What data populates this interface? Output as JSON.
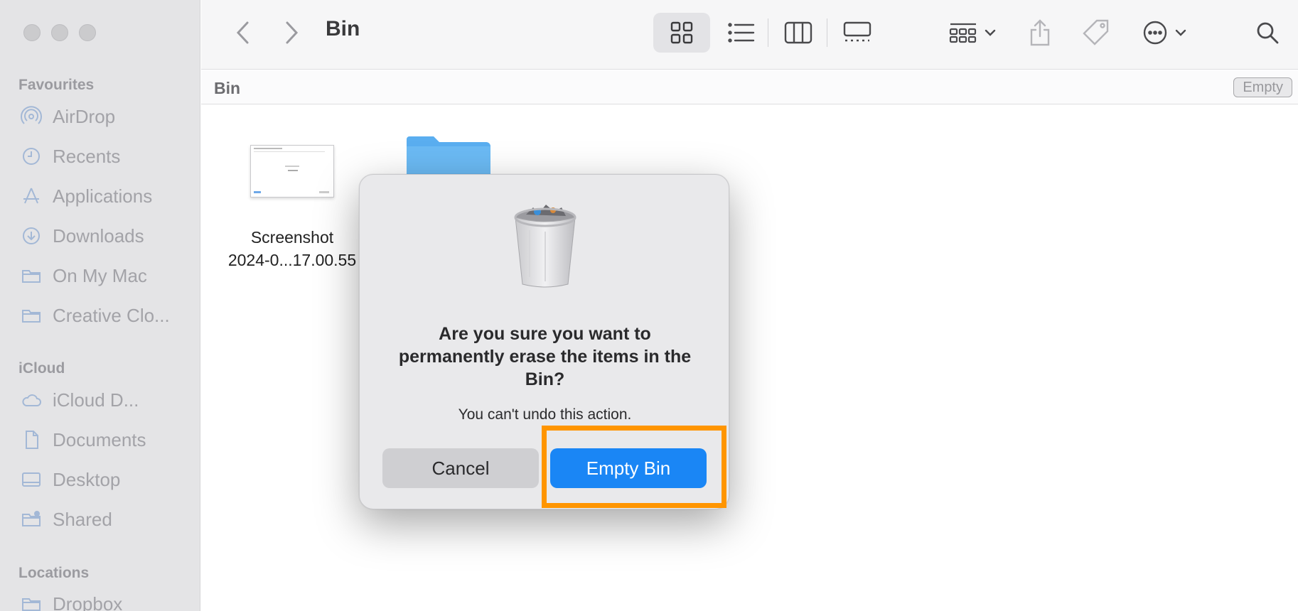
{
  "window": {
    "title": "Bin"
  },
  "sidebar": {
    "sections": [
      {
        "label": "Favourites",
        "items": [
          {
            "label": "AirDrop",
            "icon": "airdrop-icon"
          },
          {
            "label": "Recents",
            "icon": "clock-icon"
          },
          {
            "label": "Applications",
            "icon": "applications-icon"
          },
          {
            "label": "Downloads",
            "icon": "download-icon"
          },
          {
            "label": "On My Mac",
            "icon": "folder-icon"
          },
          {
            "label": "Creative Clo...",
            "icon": "folder-icon"
          }
        ]
      },
      {
        "label": "iCloud",
        "items": [
          {
            "label": "iCloud D...",
            "icon": "cloud-icon"
          },
          {
            "label": "Documents",
            "icon": "document-icon"
          },
          {
            "label": "Desktop",
            "icon": "desktop-icon"
          },
          {
            "label": "Shared",
            "icon": "shared-folder-icon"
          }
        ]
      },
      {
        "label": "Locations",
        "items": [
          {
            "label": "Dropbox",
            "icon": "folder-icon"
          }
        ]
      }
    ]
  },
  "pathbar": {
    "crumb": "Bin",
    "empty_label": "Empty"
  },
  "content": {
    "files": [
      {
        "name_line1": "Screenshot",
        "name_line2": "2024-0...17.00.55"
      }
    ]
  },
  "dialog": {
    "headline": "Are you sure you want to permanently erase the items in the Bin?",
    "message": "You can't undo this action.",
    "cancel_label": "Cancel",
    "confirm_label": "Empty Bin"
  },
  "colors": {
    "accent": "#1a86f5",
    "highlight": "#ff9500",
    "folder": "#5aaef0"
  }
}
